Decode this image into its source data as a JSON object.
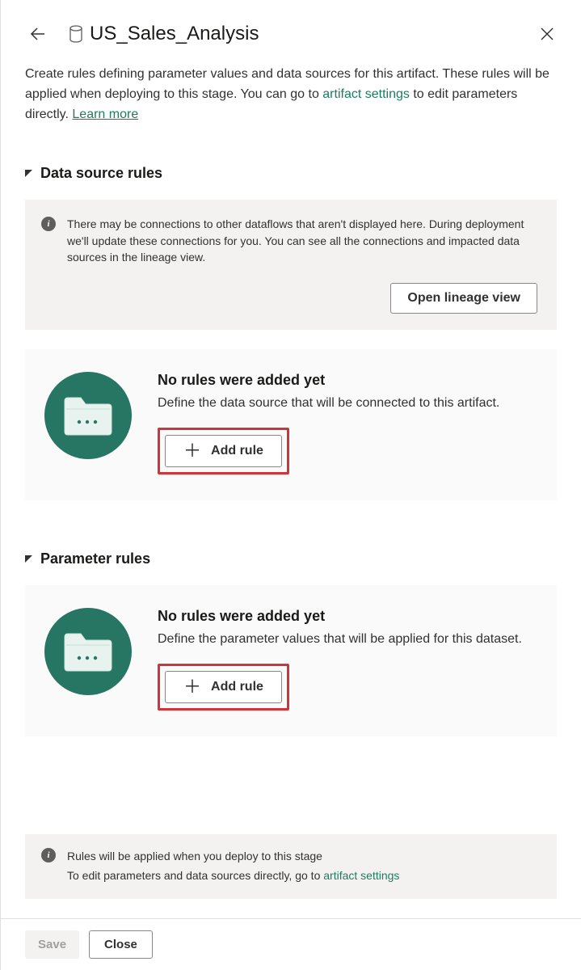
{
  "header": {
    "title": "US_Sales_Analysis"
  },
  "intro": {
    "text_before": "Create rules defining parameter values and data sources for this artifact. These rules will be applied when deploying to this stage. You can go to ",
    "artifact_link": "artifact settings",
    "text_after": " to edit parameters directly. ",
    "learn_more": "Learn more"
  },
  "dataSource": {
    "title": "Data source rules",
    "info": "There may be connections to other dataflows that aren't displayed here. During deployment we'll update these connections for you. You can see all the connections and impacted data sources in the lineage view.",
    "open_lineage": "Open lineage view",
    "empty_title": "No rules were added yet",
    "empty_desc": "Define the data source that will be connected to this artifact.",
    "add_rule": "Add rule"
  },
  "parameter": {
    "title": "Parameter rules",
    "empty_title": "No rules were added yet",
    "empty_desc": "Define the parameter values that will be applied for this dataset.",
    "add_rule": "Add rule"
  },
  "footer": {
    "line1": "Rules will be applied when you deploy to this stage",
    "line2_before": "To edit parameters and data sources directly, go to ",
    "artifact_link": "artifact settings"
  },
  "buttons": {
    "save": "Save",
    "close": "Close"
  }
}
